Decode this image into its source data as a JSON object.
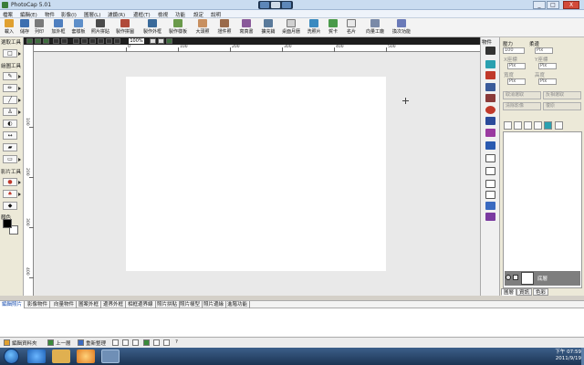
{
  "window": {
    "title": "PhotoCap 5.01",
    "buttons": [
      "_",
      "□",
      "X"
    ]
  },
  "menu": [
    "檔案",
    "編輯(E)",
    "物件",
    "影像(I)",
    "圖層(L)",
    "濾鏡(R)",
    "邊框(T)",
    "檢視",
    "功能",
    "設定",
    "說明"
  ],
  "toolbar": {
    "items": [
      "載入",
      "儲存",
      "列印",
      "加外框",
      "套樣板",
      "照片拼貼",
      "製作拼圖",
      "製作外框",
      "製作樣板",
      "大頭照",
      "證件照",
      "寫真書",
      "擴充銷",
      "桌面月曆",
      "洗照片",
      "賀卡",
      "名片",
      "向量工廠",
      "換次功能"
    ]
  },
  "left_panel": {
    "sections": [
      "選取工具",
      "繪圖工具",
      "影片工具",
      "顏色"
    ]
  },
  "canvas": {
    "zoom": "100%",
    "ruler_top_labels": [
      "0",
      "100",
      "200",
      "300",
      "400",
      "500"
    ],
    "ruler_left_labels": [
      "100",
      "200",
      "300",
      "400"
    ]
  },
  "object_strip": {
    "title": "物件"
  },
  "properties": {
    "opacity_label": "壓力",
    "flow_label": "柔邊",
    "opacity_value": "100",
    "flow_value": "Pix",
    "x_label": "X座標",
    "y_label": "Y座標",
    "w_label": "寬度",
    "h_label": "高度",
    "x_value": "Pix",
    "y_value": "Pix",
    "w_value": "Pix",
    "h_value": "Pix",
    "btn_cancel_select": "取消選取",
    "btn_flip_objects": "反相選取",
    "btn_clear_image": "清除影像",
    "btn_add_text": "復原"
  },
  "layers": {
    "background_name": "底層"
  },
  "panel_tabs": [
    "圖層",
    "資訊",
    "色彩"
  ],
  "bottom_tabs": [
    "編輯照片",
    "影像物件",
    "向量物件",
    "圖案外框",
    "邊界外框",
    "相框邊界線",
    "照片拼貼",
    "照片樣型",
    "照片邊緣",
    "進階功能"
  ],
  "bottom_bar": {
    "item1": "編輯資料夾",
    "item2": "上一層",
    "item3": "重新整理",
    "help": "?"
  },
  "taskbar": {
    "time": "下午 07:59",
    "date": "2011/9/19"
  },
  "colors": {
    "foreground": "#000000",
    "background": "#ffffff"
  }
}
